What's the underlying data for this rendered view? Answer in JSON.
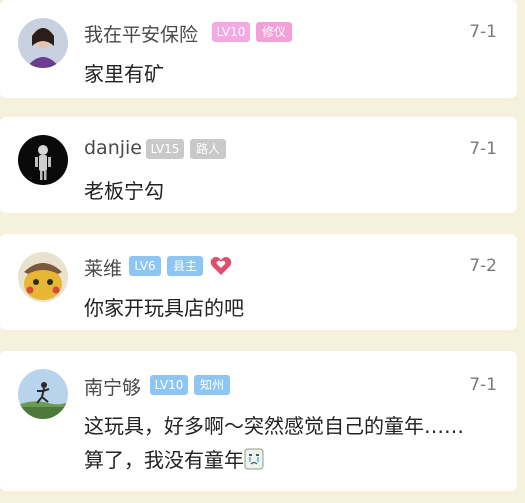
{
  "comments": [
    {
      "username": "我在平安保险",
      "level": "LV10",
      "title": "修仪",
      "date": "7-1",
      "content": "家里有矿",
      "level_color": "#f4a9e4",
      "title_color": "#f3a0d8"
    },
    {
      "username": "danjie",
      "level": "LV15",
      "title": "路人",
      "date": "7-1",
      "content": "老板宁勾",
      "level_color": "#c9c9c9",
      "title_color": "#c9c9c9"
    },
    {
      "username": "莱维",
      "level": "LV6",
      "title": "县主",
      "date": "7-2",
      "content": "你家开玩具店的吧",
      "level_color": "#8ec6f3",
      "title_color": "#8ec6f3",
      "extra_icon": "heart-icon"
    },
    {
      "username": "南宁够",
      "level": "LV10",
      "title": "知州",
      "date": "7-1",
      "content_line1": "这玩具，好多啊～突然感觉自己的童年……",
      "content_line2": "算了，我没有童年",
      "emoji_icon": "crying-face-icon",
      "level_color": "#8ec6f3",
      "title_color": "#8ec6f3"
    }
  ]
}
